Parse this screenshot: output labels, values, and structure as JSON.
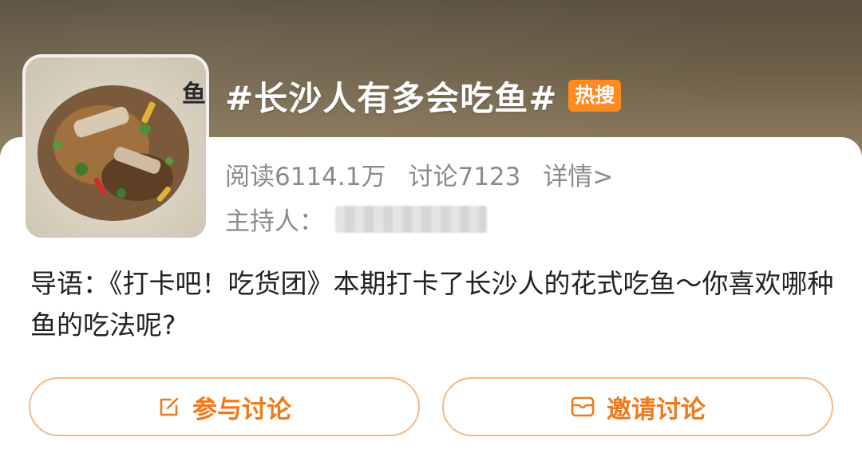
{
  "topic": {
    "title": "#长沙人有多会吃鱼#",
    "badge": "热搜",
    "thumbnail_caption_char": "鱼"
  },
  "stats": {
    "reads": "阅读6114.1万",
    "discussions": "讨论7123",
    "details": "详情>"
  },
  "host": {
    "label": "主持人："
  },
  "intro": {
    "text": "导语：《打卡吧！吃货团》本期打卡了长沙人的花式吃鱼～你喜欢哪种鱼的吃法呢?"
  },
  "actions": {
    "join": "参与讨论",
    "invite": "邀请讨论"
  },
  "colors": {
    "accent": "#f07a1a",
    "badge": "#ff8a1f",
    "button_border": "#f3b98c"
  }
}
